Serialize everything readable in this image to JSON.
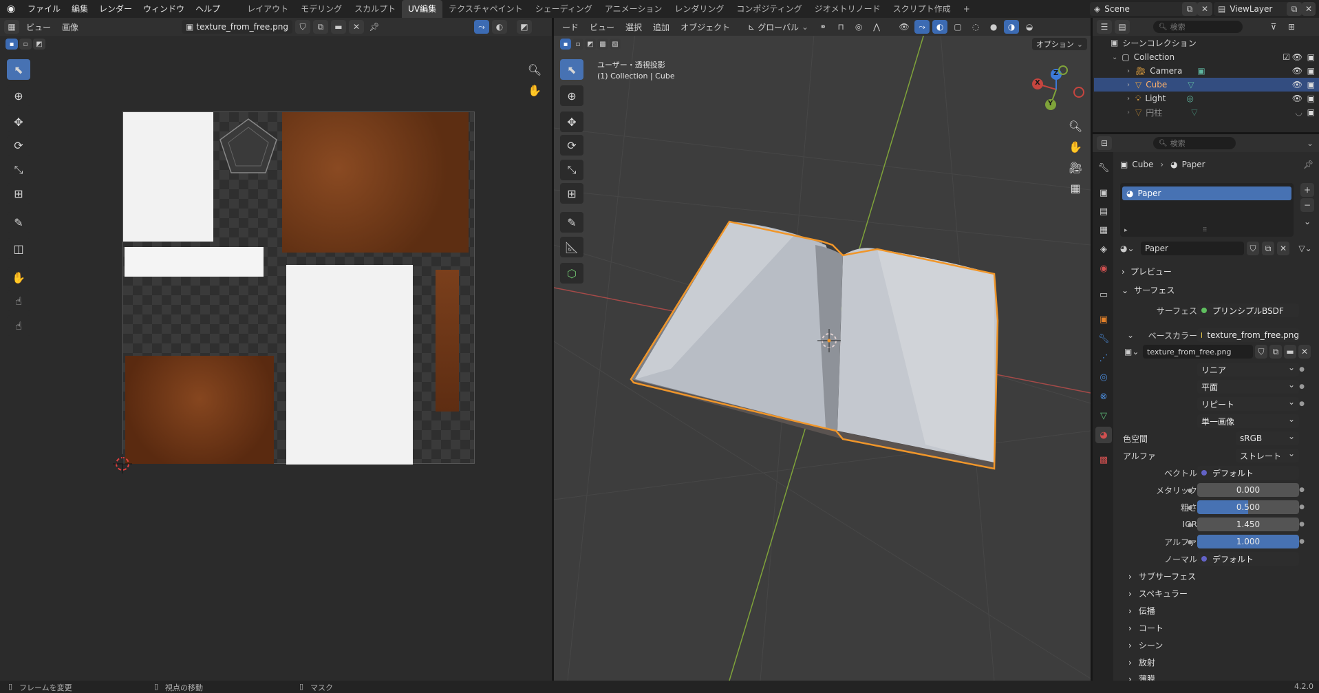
{
  "topbar": {
    "menus": [
      "ファイル",
      "編集",
      "レンダー",
      "ウィンドウ",
      "ヘルプ"
    ],
    "workspaces": [
      "レイアウト",
      "モデリング",
      "スカルプト",
      "UV編集",
      "テクスチャペイント",
      "シェーディング",
      "アニメーション",
      "レンダリング",
      "コンポジティング",
      "ジオメトリノード",
      "スクリプト作成"
    ],
    "active_workspace": "UV編集",
    "add_tab": "+",
    "scene": "Scene",
    "view_layer": "ViewLayer"
  },
  "uv_editor": {
    "menus": [
      "ビュー",
      "画像"
    ],
    "image_name": "texture_from_free.png"
  },
  "viewport": {
    "menus": [
      "ード",
      "ビュー",
      "選択",
      "追加",
      "オブジェクト"
    ],
    "transform_orientation": "グローバル",
    "options_label": "オプション",
    "view_name": "ユーザー・透視投影",
    "collection_info": "(1) Collection | Cube",
    "gizmo": {
      "x": "X",
      "y": "Y",
      "z": "Z"
    }
  },
  "outliner": {
    "search_placeholder": "検索",
    "root": "シーンコレクション",
    "collection": "Collection",
    "items": [
      {
        "label": "Camera",
        "icon": "camera-icon",
        "selected": false
      },
      {
        "label": "Cube",
        "icon": "mesh-icon",
        "selected": true
      },
      {
        "label": "Light",
        "icon": "light-icon",
        "selected": false
      },
      {
        "label": "円柱",
        "icon": "mesh-icon",
        "selected": false
      }
    ]
  },
  "properties": {
    "search_placeholder": "検索",
    "breadcrumb_object": "Cube",
    "breadcrumb_material": "Paper",
    "material_slot": "Paper",
    "material_name": "Paper",
    "sections": {
      "preview": "プレビュー",
      "surface": "サーフェス"
    },
    "surface_label": "サーフェス",
    "surface_value": "プリンシプルBSDF",
    "base_color_label": "ベースカラー",
    "base_color_value": "texture_from_free.png",
    "image_name": "texture_from_free.png",
    "interpolation": "リニア",
    "projection": "平面",
    "extension": "リピート",
    "source": "単一画像",
    "color_space_label": "色空間",
    "color_space": "sRGB",
    "alpha_mode_label": "アルファ",
    "alpha_mode": "ストレート",
    "vector_label": "ベクトル",
    "vector_value": "デフォルト",
    "metallic_label": "メタリック",
    "metallic_value": "0.000",
    "roughness_label": "粗さ",
    "roughness_value": "0.500",
    "roughness_fraction": 0.5,
    "ior_label": "IOR",
    "ior_value": "1.450",
    "alpha_label": "アルファ",
    "alpha_value": "1.000",
    "alpha_fraction": 1.0,
    "normal_label": "ノーマル",
    "normal_value": "デフォルト",
    "collapsed_sections": [
      "サブサーフェス",
      "スペキュラー",
      "伝播",
      "コート",
      "シーン",
      "放射",
      "薄膜"
    ]
  },
  "status": {
    "left": "フレームを変更",
    "middle": "視点の移動",
    "right": "マスク",
    "version": "4.2.0"
  },
  "colors": {
    "accent_blue": "#4772b3",
    "selection_orange": "#f0962a",
    "x_axis": "#c6453f",
    "y_axis": "#7fa33a",
    "leather": "#7a3f1c",
    "paper": "#f2f2f2"
  }
}
